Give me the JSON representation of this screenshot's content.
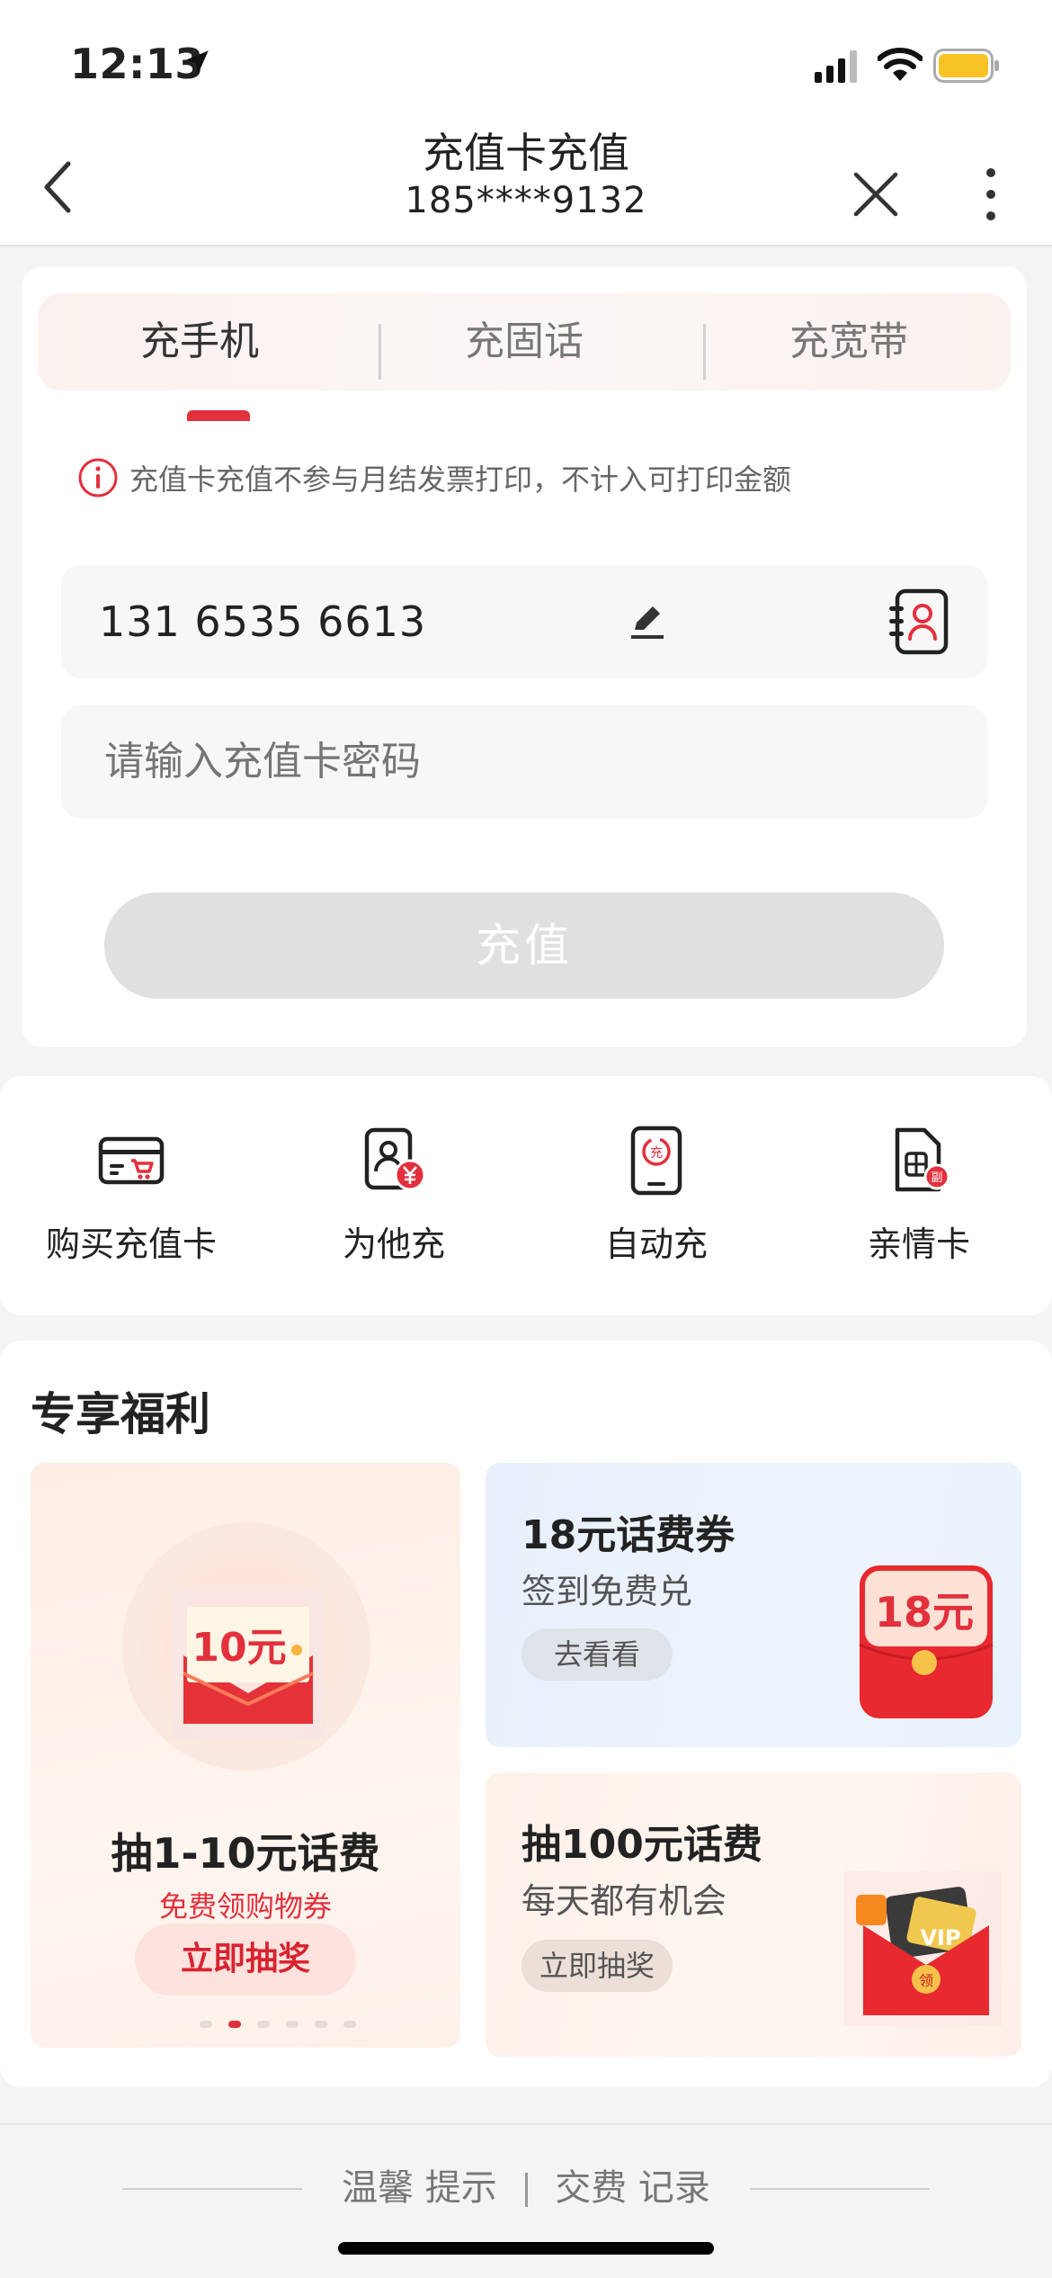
{
  "status_bar": {
    "time": "12:13"
  },
  "nav": {
    "title": "充值卡充值",
    "subtitle": "185****9132"
  },
  "tabs": [
    {
      "label": "充手机",
      "active": true
    },
    {
      "label": "充固话",
      "active": false
    },
    {
      "label": "充宽带",
      "active": false
    }
  ],
  "notice": "充值卡充值不参与月结发票打印，不计入可打印金额",
  "phone_number": "131 6535 6613",
  "password_placeholder": "请输入充值卡密码",
  "submit_label": "充值",
  "shortcuts": [
    {
      "label": "购买充值卡",
      "icon": "card-cart-icon"
    },
    {
      "label": "为他充",
      "icon": "person-yen-icon"
    },
    {
      "label": "自动充",
      "icon": "phone-auto-charge-icon"
    },
    {
      "label": "亲情卡",
      "icon": "sim-card-icon"
    }
  ],
  "benefits": {
    "title": "专享福利",
    "main": {
      "badge": "10元",
      "title": "抽1-10元话费",
      "subtitle": "免费领购物券",
      "button": "立即抽奖",
      "carousel_active_index": 1,
      "carousel_count": 6
    },
    "cards": [
      {
        "title": "18元话费券",
        "desc": "签到免费兑",
        "button": "去看看",
        "badge": "18元"
      },
      {
        "title": "抽100元话费",
        "desc": "每天都有机会",
        "button": "立即抽奖",
        "badge": "VIP",
        "badge2": "领"
      }
    ]
  },
  "footer": {
    "tips": "温馨 提示",
    "records": "交费 记录"
  },
  "colors": {
    "accent": "#e2303d",
    "disabled_button": "#e0e0e0",
    "battery": "#f7c325"
  }
}
